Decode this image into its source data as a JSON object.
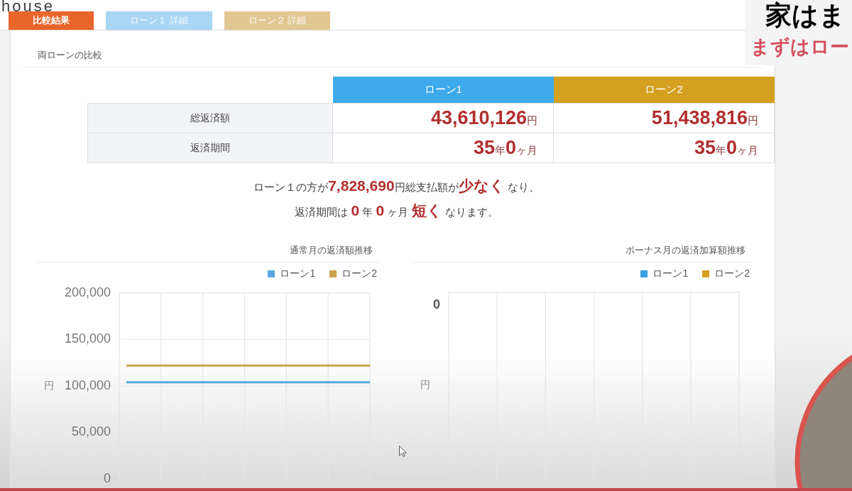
{
  "logo": {
    "text": "house"
  },
  "tabs": [
    {
      "label": "比較結果",
      "selected": true,
      "color": "#e8652b"
    },
    {
      "label": "ローン１ 詳細",
      "selected": false,
      "color": "#a9d6f5"
    },
    {
      "label": "ローン２ 詳細",
      "selected": false,
      "color": "#e2c792"
    }
  ],
  "comparison": {
    "title": "両ローンの比較",
    "columns": [
      {
        "label": "ローン1",
        "color": "#3eaaeb"
      },
      {
        "label": "ローン2",
        "color": "#d4a020"
      }
    ],
    "rows": [
      {
        "label": "総返済額",
        "values": [
          "**43,610,126**円",
          "**51,438,816**円"
        ]
      },
      {
        "label": "返済期間",
        "values": [
          "**35**年**0**ヶ月",
          "**35**年**0**ヶ月"
        ]
      }
    ],
    "summary": [
      "ローン１の方が**7,828,690**円総支払額が**少なく** なり、",
      "返済期間は **0** 年 **0** ヶ月 **短く** なります。"
    ]
  },
  "charts": [
    {
      "title": "通常月の返済額推移",
      "chart_data": {
        "type": "line",
        "ylabel": "円",
        "ylim": [
          0,
          200000
        ],
        "yticks": [
          {
            "value": 0,
            "label": "0"
          },
          {
            "value": 50000,
            "label": "50,000"
          },
          {
            "value": 100000,
            "label": "100,000"
          },
          {
            "value": 150000,
            "label": "150,000"
          },
          {
            "value": 200000,
            "label": "200,000"
          }
        ],
        "grid": true,
        "legend": true,
        "series": [
          {
            "name": "ローン1",
            "color": "#5aa7df",
            "values": [
              104000,
              104000,
              104000,
              104000,
              104000,
              104000,
              104000
            ]
          },
          {
            "name": "ローン2",
            "color": "#c9a24e",
            "values": [
              122000,
              122000,
              122000,
              122000,
              122000,
              122000,
              122000
            ]
          }
        ]
      }
    },
    {
      "title": "ボーナス月の返済加算額推移",
      "axis_label": "円",
      "tick_labels": [
        "0"
      ],
      "legend_items": [
        {
          "name": "ローン1",
          "color": "#3a9ee0"
        },
        {
          "name": "ローン2",
          "color": "#d4a020"
        }
      ]
    }
  ],
  "video_overlay": {
    "caption": "家はま",
    "subcaption": "まずはロー"
  }
}
